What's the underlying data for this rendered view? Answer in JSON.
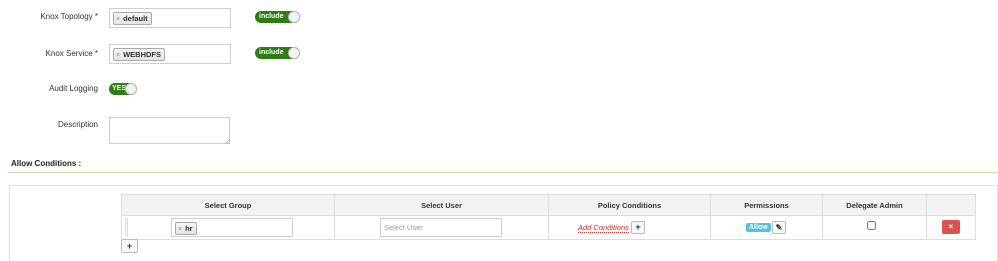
{
  "form": {
    "topology": {
      "label": "Knox Topology *",
      "tag": "default",
      "toggle": "include"
    },
    "service": {
      "label": "Knox Service *",
      "tag": "WEBHDFS",
      "toggle": "include"
    },
    "audit": {
      "label": "Audit Logging",
      "toggle": "YES"
    },
    "description": {
      "label": "Description",
      "value": ""
    }
  },
  "allow": {
    "title": "Allow Conditions :",
    "headers": [
      "Select Group",
      "Select User",
      "Policy Conditions",
      "Permissions",
      "Delegate Admin"
    ],
    "row": {
      "group_tag": "hr",
      "user_placeholder": "Select User",
      "add_conditions": "Add Conditions",
      "permission": "Allow",
      "delegate_admin": false
    }
  },
  "icons": {
    "tag_remove": "×",
    "plus": "+",
    "pencil": "✎",
    "delete": "×"
  },
  "colors": {
    "toggle_on": "#2e7d12",
    "permission_badge": "#5bc0de",
    "delete_button": "#d9534f",
    "add_conditions": "#c9302c",
    "section_rule": "#c6dfa8"
  }
}
